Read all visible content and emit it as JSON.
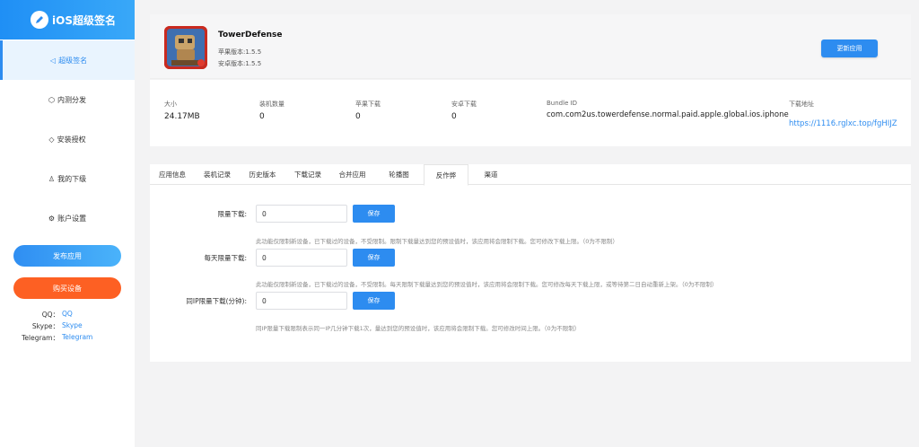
{
  "sidebar": {
    "logo_text": "iOS超级签名",
    "items": [
      {
        "icon": "◁",
        "label": "超级签名"
      },
      {
        "icon": "⬡",
        "label": "内测分发"
      },
      {
        "icon": "◇",
        "label": "安装授权"
      },
      {
        "icon": "♙",
        "label": "我的下级"
      },
      {
        "icon": "⚙",
        "label": "账户设置"
      }
    ],
    "publish_label": "发布应用",
    "buy_label": "购买设备",
    "contacts": [
      {
        "label": "QQ：",
        "value": "QQ"
      },
      {
        "label": "Skype：",
        "value": "Skype"
      },
      {
        "label": "Telegram：",
        "value": "Telegram"
      }
    ]
  },
  "app": {
    "name": "TowerDefense",
    "ios_version": "苹果版本:1.5.5",
    "android_version": "安卓版本:1.5.5",
    "update_label": "更新应用"
  },
  "stats": [
    {
      "label": "大小",
      "value": "24.17MB"
    },
    {
      "label": "装机数量",
      "value": "0"
    },
    {
      "label": "苹果下载",
      "value": "0"
    },
    {
      "label": "安卓下载",
      "value": "0"
    },
    {
      "label": "Bundle ID",
      "value": "com.com2us.towerdefense.normal.paid.apple.global.ios.iphone"
    },
    {
      "label": "下载地址",
      "value": "https://1116.rglxc.top/fgHIJZ"
    }
  ],
  "tabs": [
    "应用信息",
    "装机记录",
    "历史版本",
    "下载记录",
    "合并应用",
    "轮播图",
    "反作弊",
    "渠道"
  ],
  "form": {
    "rows": [
      {
        "label": "限量下载:",
        "value": "0",
        "save": "保存",
        "hint": "此功能仅限制新设备，已下载过的设备，不受限制。限制下载量达到您的预设值时，该应用将会限制下载。您可修改下载上限。（0为不限制）"
      },
      {
        "label": "每天限量下载:",
        "value": "0",
        "save": "保存",
        "hint": "此功能仅限制新设备，已下载过的设备，不受限制。每天限制下载量达到您的预设值时，该应用将会限制下载。您可修改每天下载上限，或等待第二日自动重新上架。（0为不限制）"
      },
      {
        "label": "同IP限量下载(分钟):",
        "value": "0",
        "save": "保存",
        "hint": "同IP限量下载限制表示同一IP几分钟下载1次，量达到您的预设值时，该应用将会限制下载。您可修改时间上限。（0为不限制）"
      }
    ]
  }
}
